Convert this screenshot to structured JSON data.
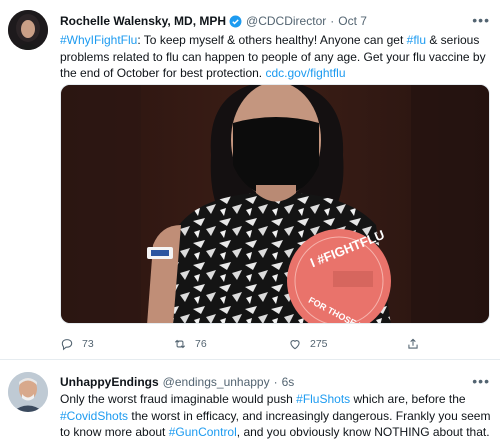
{
  "tweet": {
    "author_name": "Rochelle Walensky, MD, MPH",
    "handle": "@CDCDirector",
    "separator": "·",
    "date": "Oct 7",
    "text": {
      "hashtag1": "#WhyIFightFlu",
      "part1": ": To keep myself & others healthy! Anyone can get ",
      "hashtag2": "#flu",
      "part2": " & serious problems related to flu can happen to people of any age. Get your flu vaccine by the end of October for best protection. ",
      "link": "cdc.gov/fightflu"
    },
    "sticker_text": "I #FIGHTFLU",
    "sticker_bottom_text": "FOR THOSE WHO CANNOT",
    "replies": "73",
    "retweets": "76",
    "likes": "275"
  },
  "reply": {
    "author_name": "UnhappyEndings",
    "handle": "@endings_unhappy",
    "separator": "·",
    "time": "6s",
    "text": {
      "part1": "Only the worst fraud imaginable would push ",
      "hashtag1": "#FluShots",
      "part2": " which are, before the ",
      "hashtag2": "#CovidShots",
      "part3": " the worst in efficacy, and increasingly dangerous. Frankly you seem to know more about ",
      "hashtag3": "#GunControl",
      "part4": ", and you obviously know NOTHING about that."
    }
  },
  "icons": {
    "verified": "verified-badge-icon",
    "more": "more-icon",
    "reply": "reply-icon",
    "retweet": "retweet-icon",
    "like": "like-icon",
    "share": "share-icon"
  },
  "colors": {
    "link": "#1d9bf0",
    "secondary_text": "#536471",
    "sticker": "#e9736b"
  }
}
